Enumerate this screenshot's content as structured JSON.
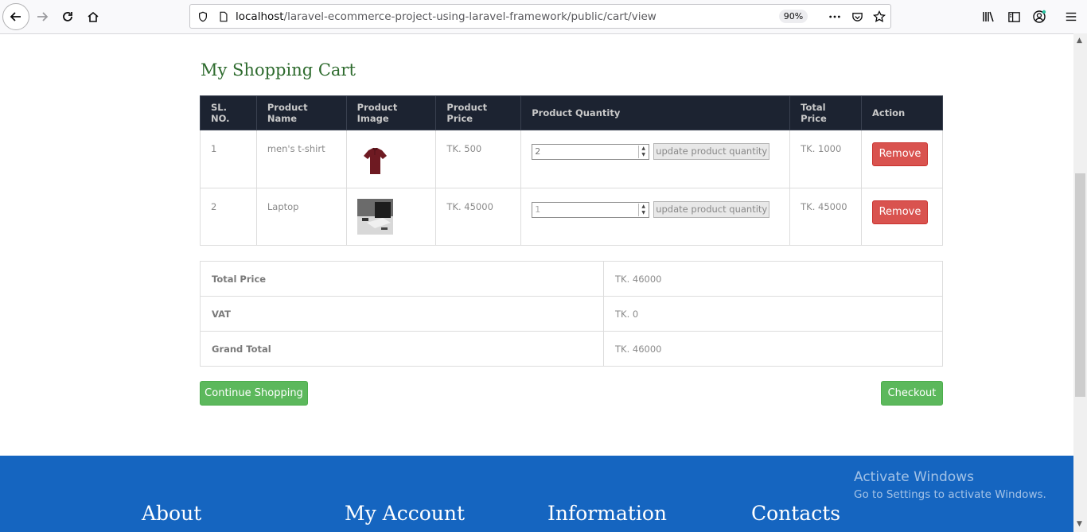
{
  "browser": {
    "url_host": "localhost",
    "url_path": "/laravel-ecommerce-project-using-laravel-framework/public/cart/view",
    "zoom": "90%"
  },
  "page": {
    "title": "My Shopping Cart"
  },
  "cart": {
    "headers": [
      "SL. NO.",
      "Product Name",
      "Product Image",
      "Product Price",
      "Product Quantity",
      "Total Price",
      "Action"
    ],
    "rows": [
      {
        "sl": "1",
        "name": "men's t-shirt",
        "image": "tshirt-image",
        "price": "TK. 500",
        "qty": "2",
        "update_label": "update product quantity",
        "total": "TK. 1000",
        "action": "Remove"
      },
      {
        "sl": "2",
        "name": "Laptop",
        "image": "laptop-image",
        "price": "TK. 45000",
        "qty": "1",
        "update_label": "update product quantity",
        "total": "TK. 45000",
        "action": "Remove"
      }
    ]
  },
  "summary": {
    "total_label": "Total Price",
    "total_value": "TK. 46000",
    "vat_label": "VAT",
    "vat_value": "TK. 0",
    "grand_label": "Grand Total",
    "grand_value": "TK. 46000"
  },
  "actions": {
    "continue": "Continue Shopping",
    "checkout": "Checkout"
  },
  "footer": {
    "about": "About",
    "account": "My Account",
    "information": "Information",
    "contacts": "Contacts"
  },
  "watermark": {
    "line1": "Activate Windows",
    "line2": "Go to Settings to activate Windows."
  },
  "colors": {
    "header_bg": "#1c2331",
    "remove": "#d9534f",
    "green": "#5cb85c",
    "footer": "#1565c0",
    "title": "#2e6b2e"
  }
}
